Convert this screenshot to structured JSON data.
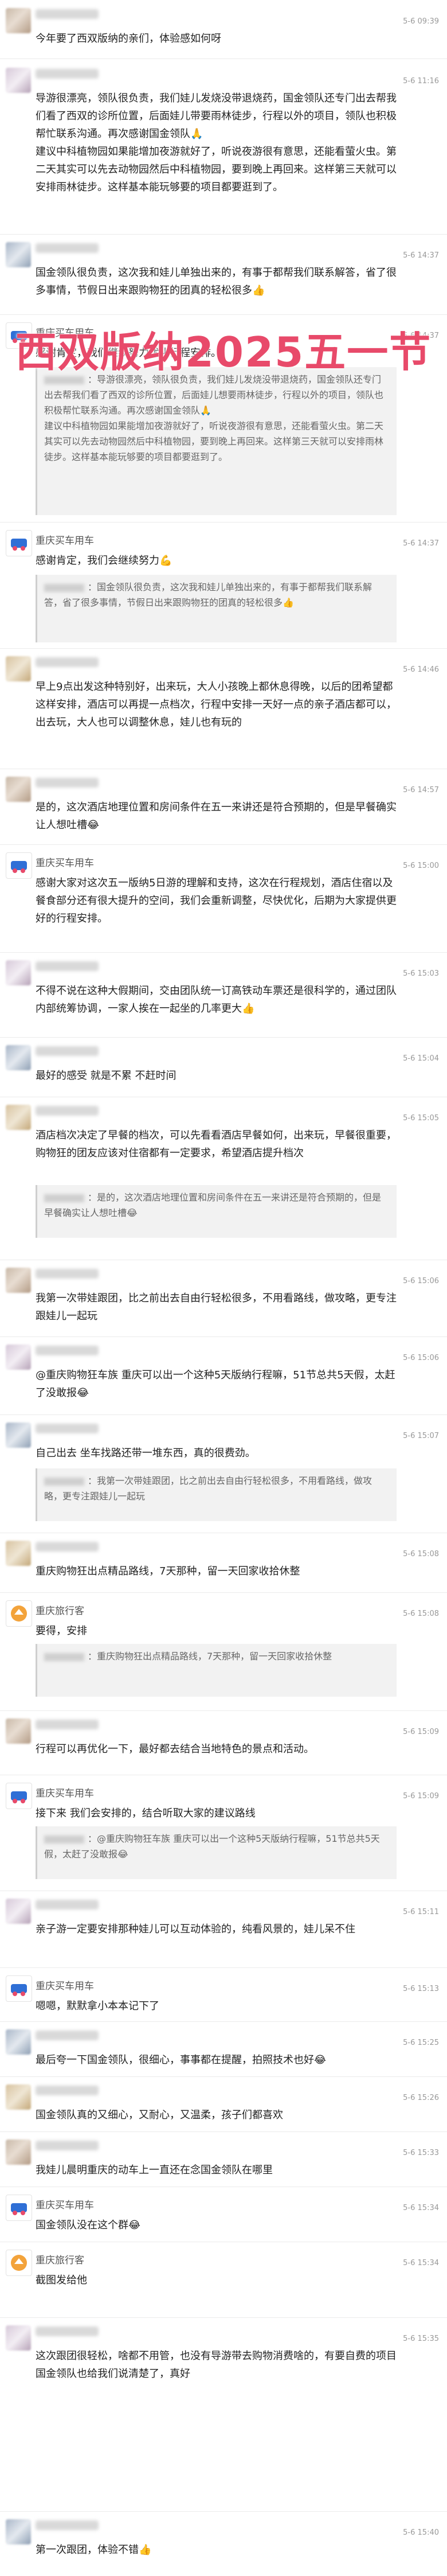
{
  "overlay_title": "西双版纳2025五一节",
  "colors": {
    "overlay": "#e84a6a",
    "time": "#999999",
    "quote_bg": "#f2f2f2"
  },
  "messages": [
    {
      "name": "",
      "time": "5-6 09:39",
      "avatar": "blurred",
      "text": "今年要了西双版纳的亲们，体验感如何呀",
      "quote": ""
    },
    {
      "name": "",
      "time": "5-6 11:16",
      "avatar": "blurred",
      "text": "导游很漂亮，领队很负责，我们娃儿发烧没带退烧药，国金领队还专门出去帮我们看了西双的诊所位置，后面娃儿带要雨林徒步，行程以外的项目，领队也积极帮忙联系沟通。再次感谢国金领队🙏\n建议中科植物园如果能增加夜游就好了，听说夜游很有意思，还能看萤火虫。第二天其实可以先去动物园然后中科植物园，要到晚上再回来。这样第三天就可以安排雨林徒步。这样基本能玩够要的项目都要逛到了。",
      "quote": ""
    },
    {
      "name": "",
      "time": "5-6 14:37",
      "avatar": "blurred",
      "text": "国金领队很负责，这次我和娃儿单独出来的，有事于都帮我们联系解答，省了很多事情，节假日出来跟购物狂的团真的轻松很多👍",
      "quote": ""
    },
    {
      "name": "重庆买车用车",
      "time": "5-6 14:37",
      "avatar": "brand",
      "text": "感谢肯定，我们继续努力优化行程安排。",
      "quote": "：导游很漂亮，领队很负责，我们娃儿发烧没带退烧药，国金领队还专门出去帮我们看了西双的诊所位置，后面娃儿想要雨林徒步，行程以外的项目，领队也积极帮忙联系沟通。再次感谢国金领队🙏\n建议中科植物园如果能增加夜游就好了，听说夜游很有意思，还能看萤火虫。第二天其实可以先去动物园然后中科植物园，要到晚上再回来。这样第三天就可以安排雨林徒步。这样基本能玩够要的项目都要逛到了。"
    },
    {
      "name": "重庆买车用车",
      "time": "5-6 14:37",
      "avatar": "brand",
      "text": "感谢肯定，我们会继续努力💪",
      "quote": "：国金领队很负责，这次我和娃儿单独出来的，有事于都帮我们联系解答，省了很多事情，节假日出来跟购物狂的团真的轻松很多👍"
    },
    {
      "name": "",
      "time": "5-6 14:46",
      "avatar": "blurred",
      "text": "早上9点出发这种特别好，出来玩，大人小孩晚上都休息得晚，以后的团希望都这样安排，酒店可以再提一点档次，行程中安排一天好一点的亲子酒店都可以，出去玩，大人也可以调整休息，娃儿也有玩的",
      "quote": ""
    },
    {
      "name": "",
      "time": "5-6 14:57",
      "avatar": "blurred",
      "text": "是的，这次酒店地理位置和房间条件在五一来讲还是符合预期的，但是早餐确实让人想吐槽😂",
      "quote": ""
    },
    {
      "name": "重庆买车用车",
      "time": "5-6 15:00",
      "avatar": "brand",
      "text": "感谢大家对这次五一版纳5日游的理解和支持，这次在行程规划，酒店住宿以及餐食部分还有很大提升的空间，我们会重新调整，尽快优化，后期为大家提供更好的行程安排。",
      "quote": ""
    },
    {
      "name": "",
      "time": "5-6 15:03",
      "avatar": "blurred",
      "text": "不得不说在这种大假期间，交由团队统一订高铁动车票还是很科学的，通过团队内部统筹协调，一家人挨在一起坐的几率更大👍",
      "quote": ""
    },
    {
      "name": "",
      "time": "5-6 15:04",
      "avatar": "blurred",
      "text": "最好的感受 就是不累 不赶时间",
      "quote": ""
    },
    {
      "name": "",
      "time": "5-6 15:05",
      "avatar": "blurred",
      "text": "酒店档次决定了早餐的档次，可以先看看酒店早餐如何，出来玩，早餐很重要，购物狂的团友应该对住宿都有一定要求，希望酒店提升档次",
      "quote": "：是的，这次酒店地理位置和房间条件在五一来讲还是符合预期的，但是早餐确实让人想吐槽😂"
    },
    {
      "name": "",
      "time": "5-6 15:06",
      "avatar": "blurred",
      "text": "我第一次带娃跟团，比之前出去自由行轻松很多，不用看路线，做攻略，更专注跟娃儿一起玩",
      "quote": ""
    },
    {
      "name": "",
      "time": "5-6 15:06",
      "avatar": "blurred",
      "text": "@重庆购物狂车族 重庆可以出一个这种5天版纳行程嘛，51节总共5天假，太赶了没敢报😂",
      "quote": ""
    },
    {
      "name": "",
      "time": "5-6 15:07",
      "avatar": "blurred",
      "text": "自己出去 坐车找路还带一堆东西，真的很费劲。",
      "quote": "：我第一次带娃跟团，比之前出去自由行轻松很多，不用看路线，做攻略，更专注跟娃儿一起玩"
    },
    {
      "name": "",
      "time": "5-6 15:08",
      "avatar": "blurred",
      "text": "重庆购物狂出点精品路线，7天那种，留一天回家收拾休整",
      "quote": ""
    },
    {
      "name": "重庆旅行客",
      "time": "5-6 15:08",
      "avatar": "brand",
      "text": "要得，安排",
      "quote": "：重庆购物狂出点精品路线，7天那种，留一天回家收拾休整"
    },
    {
      "name": "",
      "time": "5-6 15:09",
      "avatar": "blurred",
      "text": "行程可以再优化一下，最好都去结合当地特色的景点和活动。",
      "quote": ""
    },
    {
      "name": "重庆买车用车",
      "time": "5-6 15:09",
      "avatar": "brand",
      "text": "接下来 我们会安排的，结合听取大家的建议路线",
      "quote": "：@重庆购物狂车族 重庆可以出一个这种5天版纳行程嘛，51节总共5天假，太赶了没敢报😂"
    },
    {
      "name": "",
      "time": "5-6 15:11",
      "avatar": "blurred",
      "text": "亲子游一定要安排那种娃儿可以互动体验的，纯看风景的，娃儿呆不住",
      "quote": ""
    },
    {
      "name": "重庆买车用车",
      "time": "5-6 15:13",
      "avatar": "brand",
      "text": "嗯嗯，默默拿小本本记下了",
      "quote": ""
    },
    {
      "name": "",
      "time": "5-6 15:25",
      "avatar": "blurred",
      "text": "最后夸一下国金领队，很细心，事事都在提醒，拍照技术也好😂",
      "quote": ""
    },
    {
      "name": "",
      "time": "5-6 15:26",
      "avatar": "blurred",
      "text": "国金领队真的又细心，又耐心，又温柔，孩子们都喜欢",
      "quote": ""
    },
    {
      "name": "",
      "time": "5-6 15:33",
      "avatar": "blurred",
      "text": "我娃儿晨明重庆的动车上一直还在念国金领队在哪里",
      "quote": ""
    },
    {
      "name": "重庆买车用车",
      "time": "5-6 15:34",
      "avatar": "brand",
      "text": "国金领队没在这个群😂",
      "quote": ""
    },
    {
      "name": "重庆旅行客",
      "time": "5-6 15:34",
      "avatar": "brand",
      "text": "截图发给他",
      "quote": ""
    },
    {
      "name": "",
      "time": "5-6 15:35",
      "avatar": "blurred",
      "text": "这次跟团很轻松，啥都不用管，也没有导游带去购物消费啥的，有要自费的项目国金领队也给我们说清楚了，真好",
      "quote": ""
    },
    {
      "name": "",
      "time": "5-6 15:40",
      "avatar": "blurred",
      "text": "第一次跟团，体验不错👍",
      "quote": ""
    }
  ]
}
